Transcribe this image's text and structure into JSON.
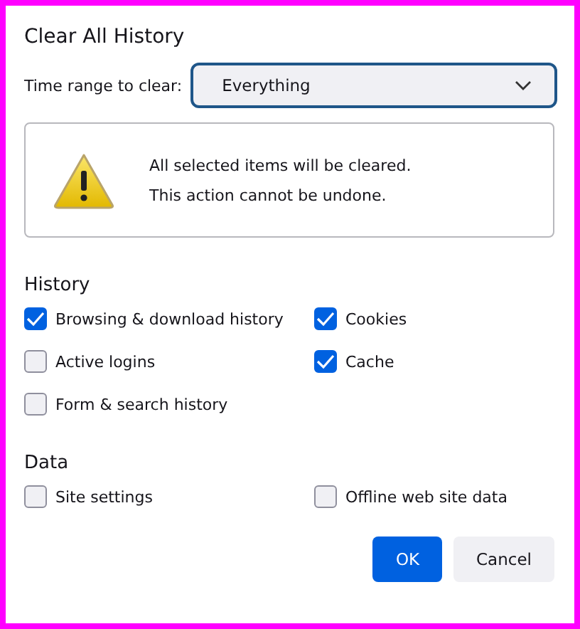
{
  "dialog": {
    "title": "Clear All History"
  },
  "time_range": {
    "label": "Time range to clear:",
    "value": "Everything"
  },
  "warning": {
    "lines": [
      "All selected items will be cleared.",
      "This action cannot be undone."
    ]
  },
  "sections": [
    {
      "heading": "History",
      "items": [
        {
          "label": "Browsing & download history",
          "checked": true
        },
        {
          "label": "Cookies",
          "checked": true
        },
        {
          "label": "Active logins",
          "checked": false
        },
        {
          "label": "Cache",
          "checked": true
        },
        {
          "label": "Form & search history",
          "checked": false
        }
      ]
    },
    {
      "heading": "Data",
      "items": [
        {
          "label": "Site settings",
          "checked": false
        },
        {
          "label": "Offline web site data",
          "checked": false
        }
      ]
    }
  ],
  "buttons": [
    {
      "label": "OK",
      "kind": "primary"
    },
    {
      "label": "Cancel",
      "kind": "secondary"
    }
  ]
}
